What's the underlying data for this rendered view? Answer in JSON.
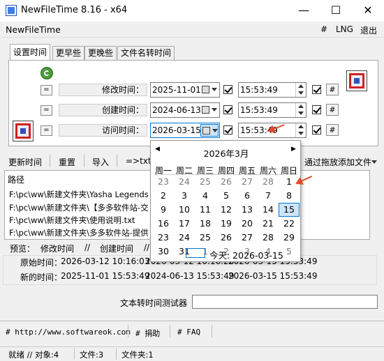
{
  "window": {
    "title": "NewFileTime 8.16 - x64",
    "minimize": "—",
    "maximize": "☐",
    "close": "✕"
  },
  "menubar": {
    "app_name": "NewFileTime",
    "hash": "#",
    "lng": "LNG",
    "exit": "退出"
  },
  "tabs": [
    "设置时间",
    "更早些",
    "更晚些",
    "文件名转时间"
  ],
  "rows": [
    {
      "eq": "=",
      "label": "修改时间：",
      "date": "2025-11-01",
      "time": "15:53:49",
      "hash": "#"
    },
    {
      "eq": "=",
      "label": "创建时间：",
      "date": "2024-06-13",
      "time": "15:53:49",
      "hash": "#"
    },
    {
      "eq": "=",
      "label": "访问时间：",
      "date": "2026-03-15",
      "time": "15:53:49",
      "hash": "#"
    }
  ],
  "actions": {
    "update": "更新时间",
    "reset": "重置",
    "import": "导入",
    "txt": "=>txt",
    "drag_add": "通过拖放添加文件"
  },
  "filelist": {
    "header": "路径",
    "items": [
      "F:\\pc\\ww\\新建文件夹\\Yasha Legends of",
      "F:\\pc\\ww\\新建文件夹\\【多多软件站-交",
      "F:\\pc\\ww\\新建文件夹\\使用说明.txt",
      "F:\\pc\\ww\\新建文件夹\\多多软件站-提供"
    ]
  },
  "preview": {
    "label": "预览：",
    "col_modified": "修改时间",
    "sep1": "//",
    "col_created": "创建时间",
    "sep2": "//",
    "orig_label": "原始时间：",
    "orig_modified": "2026-03-12 10:16:03",
    "orig_created": "2026-03-12 10:16:20",
    "orig_accessed": "2026-03-15 15:53:49",
    "new_label": "新的时间：",
    "new_modified": "2025-11-01 15:53:49",
    "new_created": "2024-06-13 15:53:49",
    "new_accessed": "2026-03-15 15:53:49"
  },
  "tester_label": "文本转时间测试器",
  "links": {
    "website": "# http://www.softwareok.com",
    "donate": "# 捐助",
    "faq": "# FAQ"
  },
  "status": {
    "ready": "就绪 // 对象:4",
    "files": "文件:3",
    "folders": "文件夹:1"
  },
  "calendar": {
    "month_label": "2026年3月",
    "prev": "◀",
    "next": "▶",
    "weekdays": [
      "周一",
      "周二",
      "周三",
      "周四",
      "周五",
      "周六",
      "周日"
    ],
    "weeks": [
      [
        "23",
        "24",
        "25",
        "26",
        "27",
        "28",
        "1"
      ],
      [
        "2",
        "3",
        "4",
        "5",
        "6",
        "7",
        "8"
      ],
      [
        "9",
        "10",
        "11",
        "12",
        "13",
        "14",
        "15"
      ],
      [
        "16",
        "17",
        "18",
        "19",
        "20",
        "21",
        "22"
      ],
      [
        "23",
        "24",
        "25",
        "26",
        "27",
        "28",
        "29"
      ],
      [
        "30",
        "31",
        "1",
        "2",
        "3",
        "4",
        "5"
      ]
    ],
    "muted_first_week": 6,
    "muted_last_week_from": 2,
    "selected": "15",
    "today_text": "今天: 2026-03-15"
  }
}
